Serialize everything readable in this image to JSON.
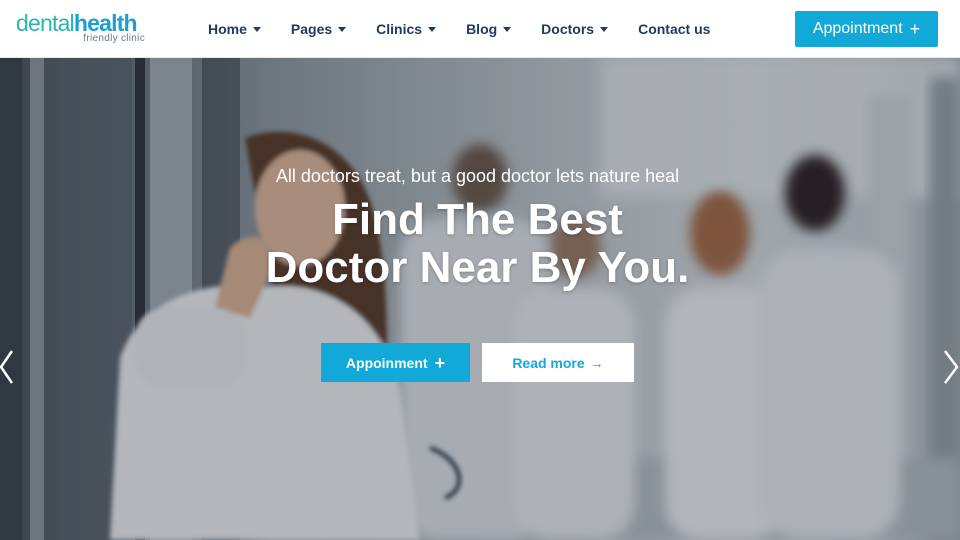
{
  "logo": {
    "brand_part1": "dental",
    "brand_part2": "health",
    "tagline": "friendly clinic"
  },
  "nav": {
    "items": [
      {
        "label": "Home",
        "has_dropdown": true
      },
      {
        "label": "Pages",
        "has_dropdown": true
      },
      {
        "label": "Clinics",
        "has_dropdown": true
      },
      {
        "label": "Blog",
        "has_dropdown": true
      },
      {
        "label": "Doctors",
        "has_dropdown": true
      },
      {
        "label": "Contact us",
        "has_dropdown": false
      }
    ]
  },
  "header": {
    "cta_label": "Appointment",
    "cta_icon": "+"
  },
  "hero": {
    "tagline": "All doctors treat, but a good doctor lets nature heal",
    "headline_line1": "Find The Best",
    "headline_line2": "Doctor Near By You.",
    "primary_button": {
      "label": "Appoinment",
      "icon": "+"
    },
    "secondary_button": {
      "label": "Read more",
      "icon": "→"
    }
  },
  "colors": {
    "accent": "#12a9d8",
    "nav_text": "#1f3b63",
    "logo_teal": "#2ab7a9"
  }
}
